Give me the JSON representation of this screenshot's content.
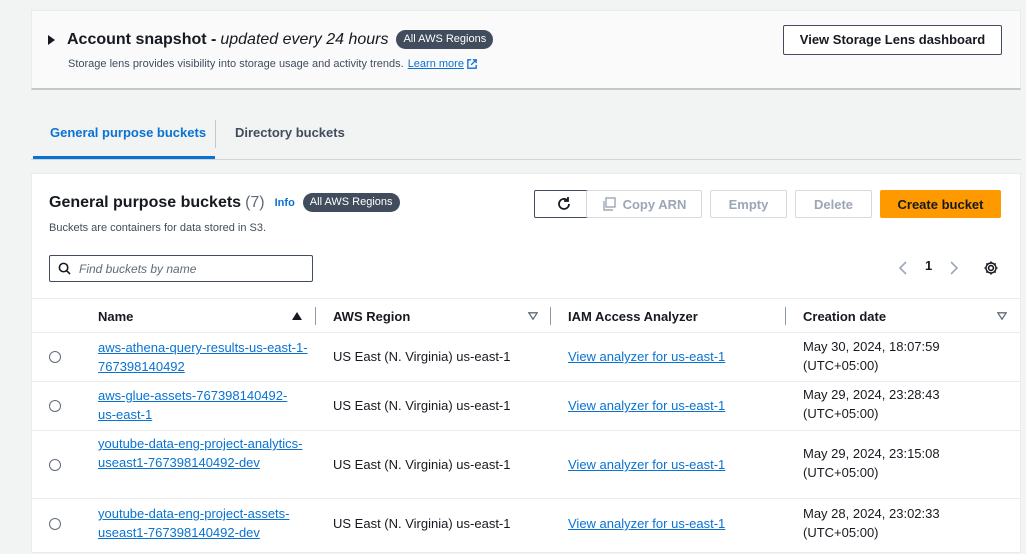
{
  "snapshot": {
    "title": "Account snapshot -",
    "subtitle": "updated every 24 hours",
    "badge": "All AWS Regions",
    "description": "Storage lens provides visibility into storage usage and activity trends.",
    "learn_more": "Learn more",
    "dashboard_button": "View Storage Lens dashboard"
  },
  "tabs": [
    {
      "label": "General purpose buckets",
      "active": true
    },
    {
      "label": "Directory buckets",
      "active": false
    }
  ],
  "panel": {
    "title": "General purpose buckets",
    "count": "(7)",
    "info": "Info",
    "badge": "All AWS Regions",
    "description": "Buckets are containers for data stored in S3.",
    "buttons": {
      "copy_arn": "Copy ARN",
      "empty": "Empty",
      "delete": "Delete",
      "create": "Create bucket"
    },
    "search_placeholder": "Find buckets by name",
    "page": "1"
  },
  "table": {
    "headers": {
      "name": "Name",
      "region": "AWS Region",
      "analyzer": "IAM Access Analyzer",
      "created": "Creation date"
    },
    "rows": [
      {
        "name": "aws-athena-query-results-us-east-1-767398140492",
        "region": "US East (N. Virginia) us-east-1",
        "analyzer": "View analyzer for us-east-1",
        "created": "May 30, 2024, 18:07:59 (UTC+05:00)"
      },
      {
        "name": "aws-glue-assets-767398140492-us-east-1",
        "region": "US East (N. Virginia) us-east-1",
        "analyzer": "View analyzer for us-east-1",
        "created": "May 29, 2024, 23:28:43 (UTC+05:00)"
      },
      {
        "name": "youtube-data-eng-project-analytics-useast1-767398140492-dev",
        "region": "US East (N. Virginia) us-east-1",
        "analyzer": "View analyzer for us-east-1",
        "created": "May 29, 2024, 23:15:08 (UTC+05:00)"
      },
      {
        "name": "youtube-data-eng-project-assets-useast1-767398140492-dev",
        "region": "US East (N. Virginia) us-east-1",
        "analyzer": "View analyzer for us-east-1",
        "created": "May 28, 2024, 23:02:33 (UTC+05:00)"
      }
    ]
  },
  "colors": {
    "primary_button": "#ff9900",
    "link": "#0972d3",
    "badge": "#414d5c"
  }
}
